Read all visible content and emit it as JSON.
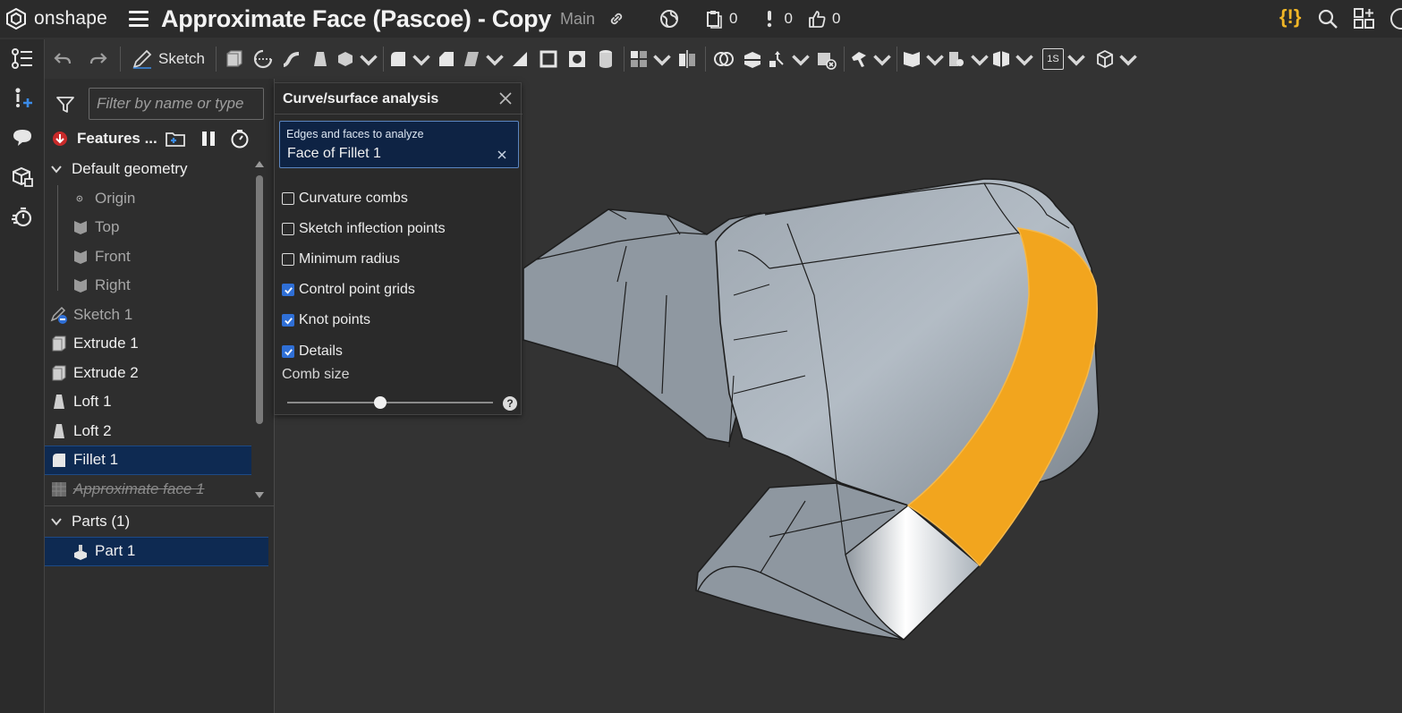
{
  "app": {
    "logo_text": "onshape"
  },
  "document": {
    "title": "Approximate Face (Pascoe) - Copy",
    "branch": "Main"
  },
  "header": {
    "versions_count": "0",
    "notifications_count": "0",
    "likes_count": "0"
  },
  "toolbar": {
    "sketch_label": "Sketch",
    "view_label": "1S"
  },
  "features": {
    "filter_placeholder": "Filter by name or type",
    "panel_title": "Features ...",
    "default_geometry_label": "Default geometry",
    "items": [
      {
        "label": "Origin"
      },
      {
        "label": "Top"
      },
      {
        "label": "Front"
      },
      {
        "label": "Right"
      },
      {
        "label": "Sketch 1"
      },
      {
        "label": "Extrude 1"
      },
      {
        "label": "Extrude 2"
      },
      {
        "label": "Loft 1"
      },
      {
        "label": "Loft 2"
      },
      {
        "label": "Fillet 1"
      },
      {
        "label": "Approximate face 1"
      }
    ],
    "parts_label": "Parts (1)",
    "parts": [
      {
        "label": "Part 1"
      }
    ]
  },
  "dialog": {
    "title": "Curve/surface analysis",
    "selection_label": "Edges and faces to analyze",
    "selection_value": "Face of Fillet 1",
    "options": [
      {
        "label": "Curvature combs",
        "checked": false
      },
      {
        "label": "Sketch inflection points",
        "checked": false
      },
      {
        "label": "Minimum radius",
        "checked": false
      },
      {
        "label": "Control point grids",
        "checked": true
      },
      {
        "label": "Knot points",
        "checked": true
      },
      {
        "label": "Details",
        "checked": true
      }
    ],
    "comb_size_label": "Comb size",
    "comb_size_value": 0.45
  },
  "colors": {
    "accent": "#2f6fd6",
    "highlight_face": "#f2a51e",
    "selection_bg": "#0e2a52",
    "warning": "#f0b526"
  }
}
